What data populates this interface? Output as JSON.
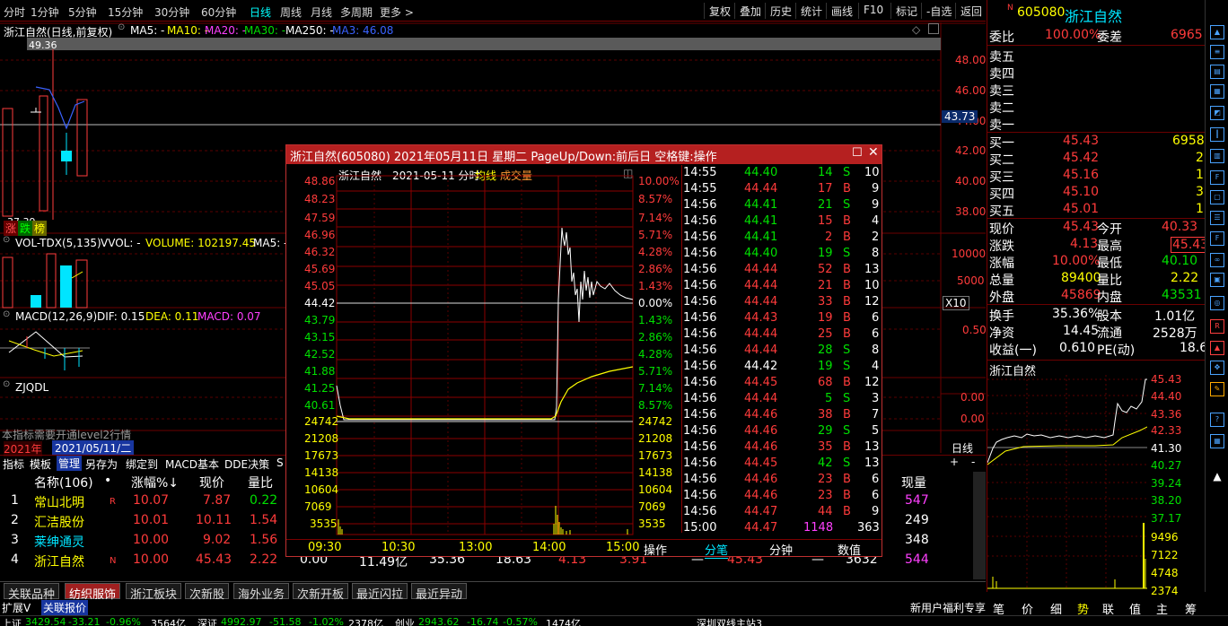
{
  "topbar": {
    "periods": [
      "分时",
      "1分钟",
      "5分钟",
      "15分钟",
      "30分钟",
      "60分钟",
      "日线",
      "周线",
      "月线",
      "多周期",
      "更多 >"
    ],
    "active": "日线",
    "tools": [
      "复权",
      "叠加",
      "历史",
      "统计",
      "画线",
      "F10",
      "标记",
      "-自选",
      "返回"
    ]
  },
  "kline": {
    "title": "浙江自然(日线,前复权)",
    "ma5": "MA5: -",
    "ma10": "MA10: -",
    "ma20": "MA20: -",
    "ma30": "MA30: -",
    "ma250": "MA250: -",
    "ma3": "MA3: 46.08",
    "high_label": "49.36",
    "low_label": "37.39",
    "price_ticks": [
      "48.00",
      "46.00",
      "44.00",
      "42.00",
      "40.00",
      "38.00"
    ],
    "cur_price": "43.73",
    "zhangdie": "涨",
    "die": "跌",
    "bang": "榜",
    "vol_title": "VOL-TDX(5,135)",
    "vol_vol": "VVOL: -",
    "vol_volume": "VOLUME: 102197.45",
    "vol_ma5": "MA5: -",
    "vol_ticks": [
      "10000",
      "5000"
    ],
    "vol_unit": "X10",
    "macd_title": "MACD(12,26,9)",
    "macd_dif": "DIF: 0.15",
    "macd_dea": "DEA: 0.11",
    "macd_macd": "MACD: 0.07",
    "macd_tick": "0.50",
    "zj_title": "ZJQDL",
    "zj_ticks": [
      "0.00",
      "0.00"
    ],
    "level2_note": "本指标需要开通level2行情",
    "year": "2021年",
    "date": "2021/05/11/二",
    "period_label": "日线",
    "plus": "+",
    "minus": "-"
  },
  "toolbar2": [
    "指标",
    "模板",
    "管理",
    "另存为",
    "绑定到",
    "MACD基本",
    "DDE决策",
    "S"
  ],
  "list": {
    "headers": {
      "name": "名称(106)",
      "dot": "•",
      "chg": "涨幅%↓",
      "price": "现价",
      "lb": "量比",
      "xl": "现量"
    },
    "rows": [
      {
        "idx": "1",
        "name": "常山北明",
        "flag": "R",
        "chg": "10.07",
        "price": "7.87",
        "lb": "0.22",
        "xl": "547"
      },
      {
        "idx": "2",
        "name": "汇洁股份",
        "flag": "",
        "chg": "10.01",
        "price": "10.11",
        "lb": "1.54",
        "xl": "249"
      },
      {
        "idx": "3",
        "name": "莱绅通灵",
        "flag": "",
        "chg": "10.00",
        "price": "9.02",
        "lb": "1.56",
        "xl": "348"
      },
      {
        "idx": "4",
        "name": "浙江自然",
        "flag": "N",
        "chg": "10.00",
        "price": "45.43",
        "lb": "2.22",
        "xl": "544"
      }
    ],
    "row4_extra": [
      "0.00",
      "11.49亿",
      "35.36",
      "18.63",
      "4.13",
      "3.91",
      "—",
      "45.43",
      "—",
      "3632"
    ]
  },
  "bottabs": [
    "关联品种",
    "纺织服饰",
    "浙江板块",
    "次新股",
    "海外业务",
    "次新开板",
    "最近闪拉",
    "最近异动"
  ],
  "bottabs_active": "纺织服饰",
  "expand": {
    "a": "扩展V",
    "b": "关联报价"
  },
  "status": {
    "sh": "上证",
    "sh_v": "3429.54",
    "sh_c": "-33.21",
    "sh_p": "-0.96%",
    "sh_a": "3564亿",
    "sz": "深证",
    "sz_v": "4992.97",
    "sz_c": "-51.58",
    "sz_p": "-1.02%",
    "sz_a": "2378亿",
    "cy": "创业",
    "cy_v": "2943.62",
    "cy_c": "-16.74",
    "cy_p": "-0.57%",
    "cy_a": "1474亿",
    "sys": "深圳双线主站3",
    "promo": "新用户福利专享"
  },
  "quote": {
    "code": "605080",
    "name": "浙江自然",
    "badge": "N",
    "wb_label": "委比",
    "wb": "100.00%",
    "wc_label": "委差",
    "wc": "6965",
    "sell": [
      "卖五",
      "卖四",
      "卖三",
      "卖二",
      "卖一"
    ],
    "buy": [
      {
        "l": "买一",
        "p": "45.43",
        "v": "6958"
      },
      {
        "l": "买二",
        "p": "45.42",
        "v": "2"
      },
      {
        "l": "买三",
        "p": "45.16",
        "v": "1"
      },
      {
        "l": "买四",
        "p": "45.10",
        "v": "3"
      },
      {
        "l": "买五",
        "p": "45.01",
        "v": "1"
      }
    ],
    "stats": [
      {
        "l1": "现价",
        "v1": "45.43",
        "l2": "今开",
        "v2": "40.33"
      },
      {
        "l1": "涨跌",
        "v1": "4.13",
        "l2": "最高",
        "v2": "45.43"
      },
      {
        "l1": "涨幅",
        "v1": "10.00%",
        "l2": "最低",
        "v2": "40.10"
      },
      {
        "l1": "总量",
        "v1": "89400",
        "l2": "量比",
        "v2": "2.22"
      },
      {
        "l1": "外盘",
        "v1": "45869",
        "l2": "内盘",
        "v2": "43531"
      }
    ],
    "stats2": [
      {
        "l1": "换手",
        "v1": "35.36%",
        "l2": "股本",
        "v2": "1.01亿"
      },
      {
        "l1": "净资",
        "v1": "14.45",
        "l2": "流通",
        "v2": "2528万"
      },
      {
        "l1": "收益(一)",
        "v1": "0.610",
        "l2": "PE(动)",
        "v2": "18.6"
      }
    ],
    "mini_title": "浙江自然",
    "mini_ticks": [
      "45.43",
      "44.40",
      "43.36",
      "42.33",
      "41.30",
      "40.27",
      "39.24",
      "38.20",
      "37.17"
    ],
    "mini_vol_ticks": [
      "9496",
      "7122",
      "4748",
      "2374"
    ],
    "tabs": [
      "笔",
      "价",
      "细",
      "势",
      "联",
      "值",
      "主",
      "筹"
    ],
    "tabs_active": "势"
  },
  "popup": {
    "title": "浙江自然(605080) 2021年05月11日 星期二 PageUp/Down:前后日 空格键:操作",
    "sub_name": "浙江自然",
    "sub_date": "2021-05-11 分时",
    "sub_avg": "均线",
    "sub_vol": "成交量",
    "left_ticks": [
      "48.86",
      "48.23",
      "47.59",
      "46.96",
      "46.32",
      "45.69",
      "45.05",
      "44.42",
      "43.79",
      "43.15",
      "42.52",
      "41.88",
      "41.25",
      "40.61"
    ],
    "right_ticks": [
      "10.00%",
      "8.57%",
      "7.14%",
      "5.71%",
      "4.28%",
      "2.86%",
      "1.43%",
      "0.00%",
      "1.43%",
      "2.86%",
      "4.28%",
      "5.71%",
      "7.14%",
      "8.57%"
    ],
    "vol_ticks": [
      "24742",
      "21208",
      "17673",
      "14138",
      "10604",
      "7069",
      "3535"
    ],
    "time_ticks": [
      "09:30",
      "10:30",
      "13:00",
      "14:00",
      "15:00"
    ],
    "op": "操作",
    "tabs": [
      "分笔",
      "分钟",
      "数值"
    ],
    "ticks": [
      {
        "t": "14:55",
        "p": "44.40",
        "v": "14",
        "s": "S",
        "n": "10"
      },
      {
        "t": "14:55",
        "p": "44.44",
        "v": "17",
        "s": "B",
        "n": "9"
      },
      {
        "t": "14:56",
        "p": "44.41",
        "v": "21",
        "s": "S",
        "n": "9"
      },
      {
        "t": "14:56",
        "p": "44.41",
        "v": "15",
        "s": "B",
        "n": "4"
      },
      {
        "t": "14:56",
        "p": "44.41",
        "v": "2",
        "s": "B",
        "n": "2"
      },
      {
        "t": "14:56",
        "p": "44.40",
        "v": "19",
        "s": "S",
        "n": "8"
      },
      {
        "t": "14:56",
        "p": "44.44",
        "v": "52",
        "s": "B",
        "n": "13"
      },
      {
        "t": "14:56",
        "p": "44.44",
        "v": "21",
        "s": "B",
        "n": "10"
      },
      {
        "t": "14:56",
        "p": "44.44",
        "v": "33",
        "s": "B",
        "n": "12"
      },
      {
        "t": "14:56",
        "p": "44.43",
        "v": "19",
        "s": "B",
        "n": "6"
      },
      {
        "t": "14:56",
        "p": "44.44",
        "v": "25",
        "s": "B",
        "n": "6"
      },
      {
        "t": "14:56",
        "p": "44.44",
        "v": "28",
        "s": "S",
        "n": "8"
      },
      {
        "t": "14:56",
        "p": "44.42",
        "v": "19",
        "s": "S",
        "n": "4"
      },
      {
        "t": "14:56",
        "p": "44.45",
        "v": "68",
        "s": "B",
        "n": "12"
      },
      {
        "t": "14:56",
        "p": "44.44",
        "v": "5",
        "s": "S",
        "n": "3"
      },
      {
        "t": "14:56",
        "p": "44.46",
        "v": "38",
        "s": "B",
        "n": "7"
      },
      {
        "t": "14:56",
        "p": "44.46",
        "v": "29",
        "s": "S",
        "n": "5"
      },
      {
        "t": "14:56",
        "p": "44.46",
        "v": "35",
        "s": "B",
        "n": "13"
      },
      {
        "t": "14:56",
        "p": "44.45",
        "v": "42",
        "s": "S",
        "n": "13"
      },
      {
        "t": "14:56",
        "p": "44.46",
        "v": "23",
        "s": "B",
        "n": "6"
      },
      {
        "t": "14:56",
        "p": "44.46",
        "v": "23",
        "s": "B",
        "n": "6"
      },
      {
        "t": "14:56",
        "p": "44.47",
        "v": "44",
        "s": "B",
        "n": "9"
      },
      {
        "t": "15:00",
        "p": "44.47",
        "v": "1148",
        "s": "",
        "n": "363"
      }
    ]
  }
}
